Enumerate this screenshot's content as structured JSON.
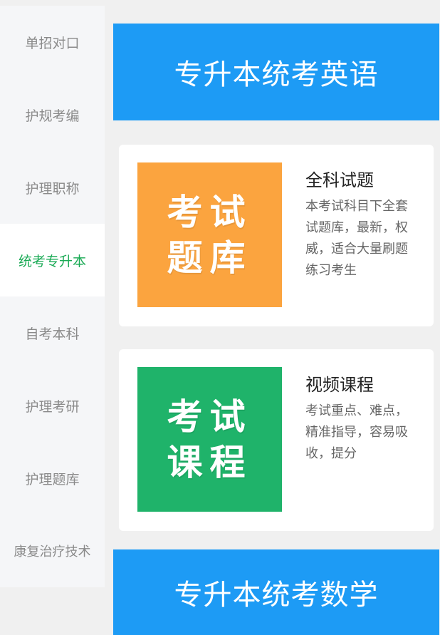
{
  "sidebar": {
    "items": [
      {
        "label": "单招对口",
        "active": false
      },
      {
        "label": "护规考编",
        "active": false
      },
      {
        "label": "护理职称",
        "active": false
      },
      {
        "label": "统考专升本",
        "active": true
      },
      {
        "label": "自考本科",
        "active": false
      },
      {
        "label": "护理考研",
        "active": false
      },
      {
        "label": "护理题库",
        "active": false
      },
      {
        "label": "康复治疗技术",
        "active": false
      }
    ]
  },
  "main": {
    "banner_top": "专升本统考英语",
    "cards": [
      {
        "thumb_line1": "考试",
        "thumb_line2": "题库",
        "title": "全科试题",
        "desc": "本考试科目下全套试题库，最新，权威，适合大量刷题练习考生"
      },
      {
        "thumb_line1": "考试",
        "thumb_line2": "课程",
        "title": "视频课程",
        "desc": "考试重点、难点，精准指导，容易吸收，提分"
      }
    ],
    "banner_bottom": "专升本统考数学"
  },
  "colors": {
    "accent_blue": "#1d9bf5",
    "active_green": "#1aaa55",
    "thumb_orange": "#fba43f",
    "thumb_green": "#1fb36a"
  }
}
